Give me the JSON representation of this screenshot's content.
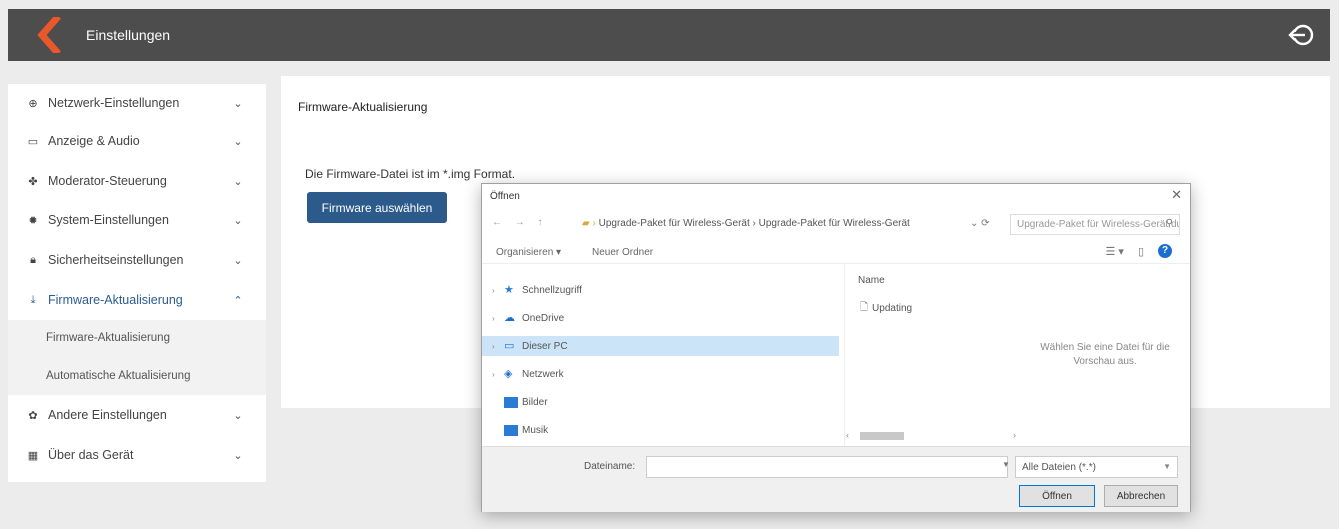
{
  "header": {
    "title": "Einstellungen"
  },
  "sidebar": {
    "items": [
      {
        "label": "Netzwerk-Einstellungen",
        "icon": "network-icon"
      },
      {
        "label": "Anzeige & Audio",
        "icon": "monitor-icon"
      },
      {
        "label": "Moderator-Steuerung",
        "icon": "moderator-icon"
      },
      {
        "label": "System-Einstellungen",
        "icon": "gear-icon"
      },
      {
        "label": "Sicherheitseinstellungen",
        "icon": "lock-icon"
      },
      {
        "label": "Firmware-Aktualisierung",
        "icon": "firmware-icon"
      },
      {
        "label": "Andere Einstellungen",
        "icon": "settings-icon"
      },
      {
        "label": "Über das Gerät",
        "icon": "device-icon"
      }
    ],
    "subitems": [
      "Firmware-Aktualisierung",
      "Automatische Aktualisierung"
    ]
  },
  "main": {
    "section_title": "Firmware-Aktualisierung",
    "info_text": "Die Firmware-Datei ist im *.img Format.",
    "button_label": "Firmware auswählen"
  },
  "dialog": {
    "title": "Öffnen",
    "close": "✕",
    "breadcrumb": "Upgrade-Paket für Wireless-Gerät  ›  Upgrade-Paket für Wireless-Gerät",
    "search_placeholder": "Upgrade-Paket für Wireless-Gerät durchsuchen",
    "organize": "Organisieren ▾",
    "new_folder": "Neuer Ordner",
    "tree": [
      {
        "label": "Schnellzugriff",
        "icon": "star-icon"
      },
      {
        "label": "OneDrive",
        "icon": "cloud-icon"
      },
      {
        "label": "Dieser PC",
        "icon": "pc-icon"
      },
      {
        "label": "Netzwerk",
        "icon": "network-icon"
      },
      {
        "label": "Bilder",
        "icon": "pictures-folder-icon"
      },
      {
        "label": "Musik",
        "icon": "music-folder-icon"
      }
    ],
    "column_header": "Name",
    "file_name": "Updating",
    "no_preview": "Wählen Sie eine Datei für die Vorschau aus.",
    "filename_label": "Dateiname:",
    "filter": "Alle Dateien (*.*)",
    "open_button": "Öffnen",
    "cancel_button": "Abbrechen"
  },
  "colors": {
    "topbar": "#4d4d4d",
    "accent": "#2c5a8a",
    "logo": "#e8582a",
    "selection": "#cce4f7"
  }
}
